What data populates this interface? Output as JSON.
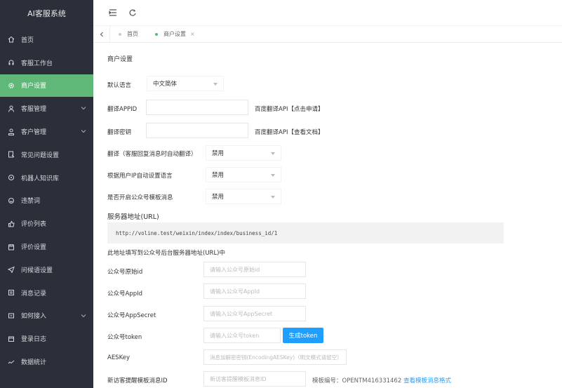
{
  "app": {
    "title": "AI客服系统"
  },
  "sidebar": {
    "items": [
      {
        "label": "首页",
        "icon": "home-icon"
      },
      {
        "label": "客服工作台",
        "icon": "headset-icon"
      },
      {
        "label": "商户设置",
        "icon": "gear-icon",
        "active": true
      },
      {
        "label": "客服管理",
        "icon": "user-icon",
        "expand": true
      },
      {
        "label": "客户管理",
        "icon": "customer-icon",
        "expand": true
      },
      {
        "label": "常见问题设置",
        "icon": "faq-icon"
      },
      {
        "label": "机器人知识库",
        "icon": "robot-icon"
      },
      {
        "label": "违禁词",
        "icon": "forbidden-icon"
      },
      {
        "label": "评价列表",
        "icon": "thumb-icon"
      },
      {
        "label": "评价设置",
        "icon": "calendar-icon"
      },
      {
        "label": "问候语设置",
        "icon": "send-icon"
      },
      {
        "label": "消息记录",
        "icon": "message-icon"
      },
      {
        "label": "如何接入",
        "icon": "plug-icon",
        "expand": true
      },
      {
        "label": "登录日志",
        "icon": "log-icon"
      },
      {
        "label": "数据统计",
        "icon": "stats-icon"
      }
    ]
  },
  "tabs": [
    {
      "label": "首页"
    },
    {
      "label": "商户设置",
      "active": true,
      "close": "×"
    }
  ],
  "form": {
    "section_title": "商户设置",
    "default_lang_label": "默认语言",
    "default_lang_value": "中文简体",
    "translate_appid_label": "翻译APPID",
    "translate_appid_hint": "百度翻译API【点击申请】",
    "translate_key_label": "翻译密钥",
    "translate_key_hint": "百度翻译API【查看文档】",
    "auto_translate_label": "翻译（客服回复消息时自动翻译）",
    "auto_translate_value": "禁用",
    "ip_lang_label": "根据用户IP自动设置语言",
    "ip_lang_value": "禁用",
    "template_msg_label": "是否开启公众号模板消息",
    "template_msg_value": "禁用",
    "server_url_label": "服务器地址(URL)",
    "server_url_value": "http://voline.test/weixin/index/index/business_id/1",
    "server_url_note": "此地址填写到公众号后台服务器地址(URL)中",
    "original_id_label": "公众号原始id",
    "original_id_placeholder": "请输入公众号原始id",
    "appid_label": "公众号AppId",
    "appid_placeholder": "请输入公众号AppId",
    "appsecret_label": "公众号AppSecret",
    "appsecret_placeholder": "请输入公众号AppSecret",
    "token_label": "公众号token",
    "token_placeholder": "请输入公众号token",
    "token_button": "生成token",
    "aeskey_label": "AESKey",
    "aeskey_placeholder": "消息加解密密钥(EncodingAESKey)（明文模式请留空）",
    "reminder_label": "新访客提醒模板消息ID",
    "reminder_placeholder": "新访客提醒模板消息ID",
    "template_no_label": "模板编号：OPENTM416331462",
    "template_link": "查看模板消息格式"
  },
  "colors": {
    "sidebar_bg": "#2b2f3a",
    "active": "#5fb878",
    "accent": "#1e9fff"
  }
}
